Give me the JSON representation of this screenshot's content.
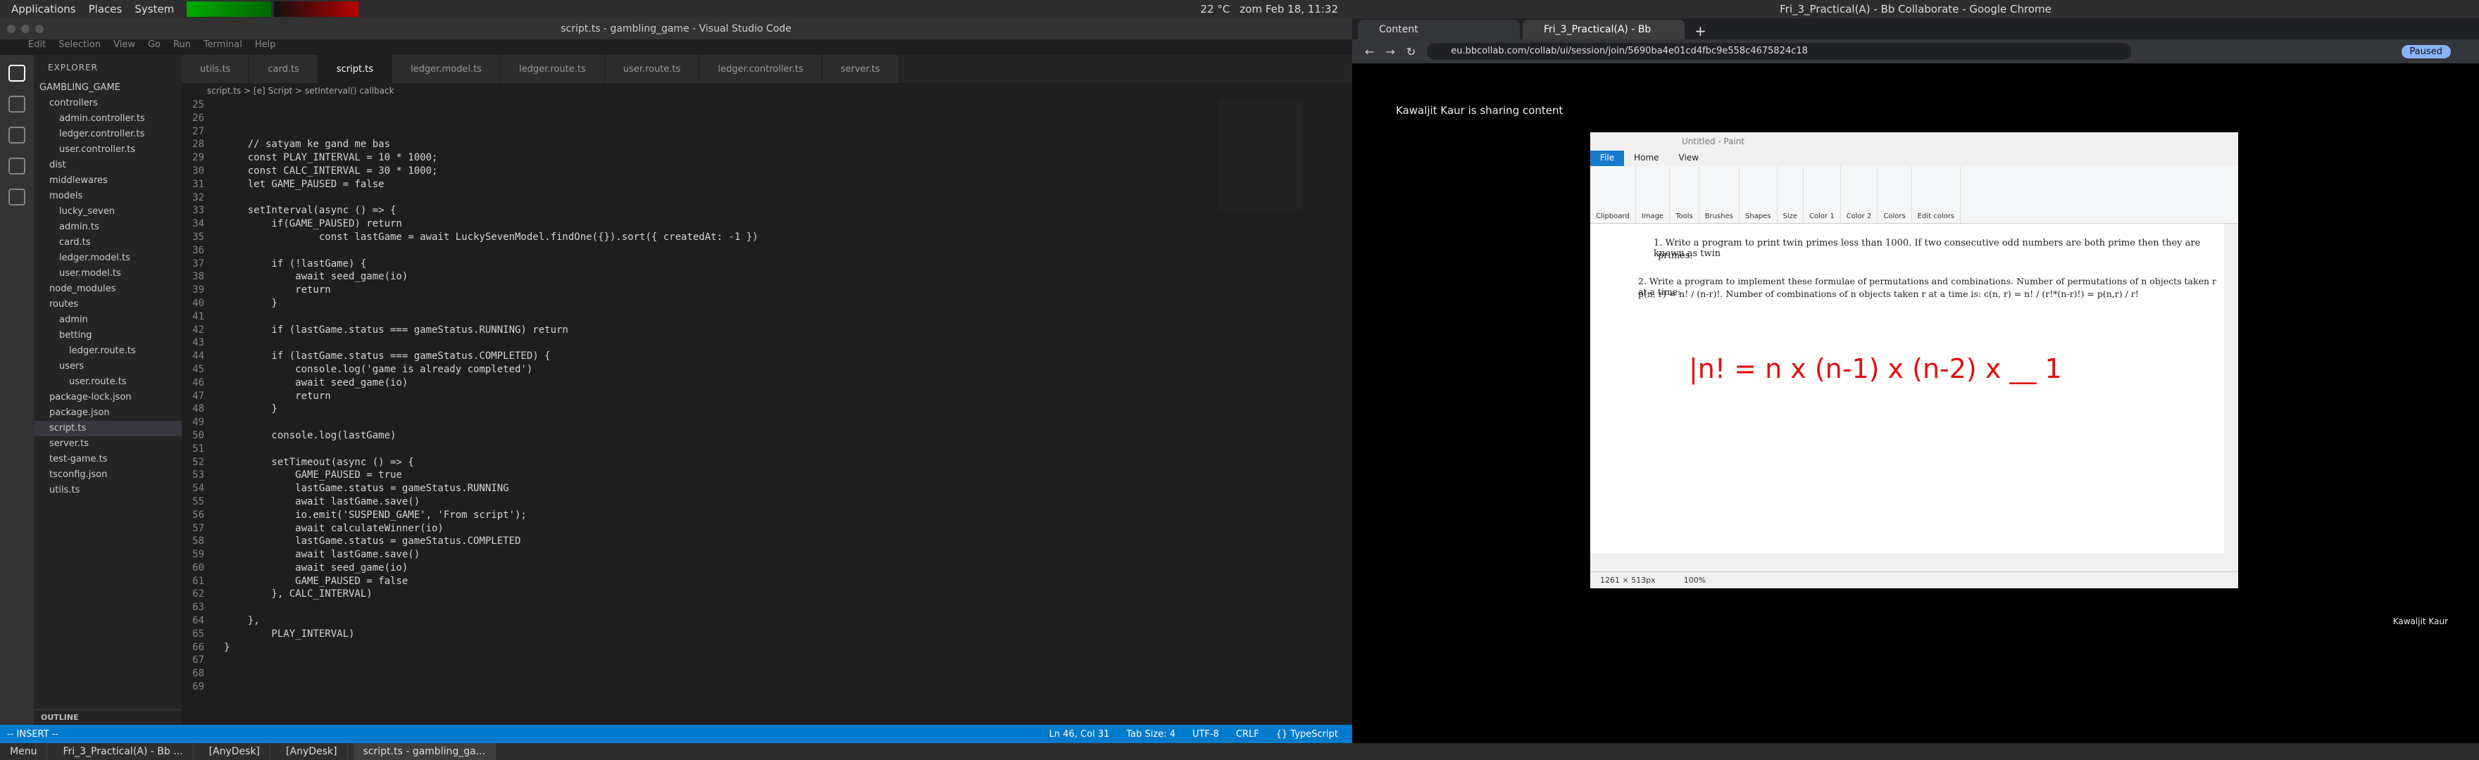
{
  "topbar": {
    "menus": [
      "Applications",
      "Places",
      "System"
    ],
    "weather": "22 °C",
    "clock": "zom Feb 18, 11:32"
  },
  "vscode": {
    "title": "script.ts - gambling_game - Visual Studio Code",
    "menu": [
      "Edit",
      "Selection",
      "View",
      "Go",
      "Run",
      "Terminal",
      "Help"
    ],
    "explorer_title": "EXPLORER",
    "tree": [
      {
        "label": "GAMBLING_GAME"
      },
      {
        "label": "controllers"
      },
      {
        "label": "admin.controller.ts"
      },
      {
        "label": "ledger.controller.ts"
      },
      {
        "label": "user.controller.ts"
      },
      {
        "label": "dist"
      },
      {
        "label": "middlewares"
      },
      {
        "label": "models"
      },
      {
        "label": "lucky_seven"
      },
      {
        "label": "admin.ts"
      },
      {
        "label": "card.ts"
      },
      {
        "label": "ledger.model.ts"
      },
      {
        "label": "user.model.ts"
      },
      {
        "label": "node_modules"
      },
      {
        "label": "routes"
      },
      {
        "label": "admin"
      },
      {
        "label": "betting"
      },
      {
        "label": "ledger.route.ts"
      },
      {
        "label": "users"
      },
      {
        "label": "user.route.ts"
      },
      {
        "label": "package-lock.json"
      },
      {
        "label": "package.json"
      },
      {
        "label": "script.ts"
      },
      {
        "label": "server.ts"
      },
      {
        "label": "test-game.ts"
      },
      {
        "label": "tsconfig.json"
      },
      {
        "label": "utils.ts"
      }
    ],
    "outline": "OUTLINE",
    "tabs": [
      "utils.ts",
      "card.ts",
      "script.ts",
      "ledger.model.ts",
      "ledger.route.ts",
      "user.route.ts",
      "ledger.controller.ts",
      "server.ts"
    ],
    "breadcrumb": "script.ts > [e] Script > setInterval() callback",
    "code_lines": [
      {
        "n": "25",
        "t": ""
      },
      {
        "n": "26",
        "t": ""
      },
      {
        "n": "27",
        "t": ""
      },
      {
        "n": "28",
        "t": "    // satyam ke gand me bas"
      },
      {
        "n": "29",
        "t": "    const PLAY_INTERVAL = 10 * 1000;"
      },
      {
        "n": "30",
        "t": "    const CALC_INTERVAL = 30 * 1000;"
      },
      {
        "n": "31",
        "t": "    let GAME_PAUSED = false"
      },
      {
        "n": "32",
        "t": ""
      },
      {
        "n": "33",
        "t": "    setInterval(async () => {"
      },
      {
        "n": "34",
        "t": "        if(GAME_PAUSED) return"
      },
      {
        "n": "35",
        "t": "                const lastGame = await LuckySevenModel.findOne({}).sort({ createdAt: -1 })"
      },
      {
        "n": "36",
        "t": ""
      },
      {
        "n": "37",
        "t": "        if (!lastGame) {"
      },
      {
        "n": "38",
        "t": "            await seed_game(io)"
      },
      {
        "n": "39",
        "t": "            return"
      },
      {
        "n": "40",
        "t": "        }"
      },
      {
        "n": "41",
        "t": ""
      },
      {
        "n": "42",
        "t": "        if (lastGame.status === gameStatus.RUNNING) return"
      },
      {
        "n": "43",
        "t": ""
      },
      {
        "n": "44",
        "t": "        if (lastGame.status === gameStatus.COMPLETED) {"
      },
      {
        "n": "45",
        "t": "            console.log('game is already completed')"
      },
      {
        "n": "46",
        "t": "            await seed_game(io)"
      },
      {
        "n": "47",
        "t": "            return"
      },
      {
        "n": "48",
        "t": "        }"
      },
      {
        "n": "49",
        "t": ""
      },
      {
        "n": "50",
        "t": "        console.log(lastGame)"
      },
      {
        "n": "51",
        "t": ""
      },
      {
        "n": "52",
        "t": "        setTimeout(async () => {"
      },
      {
        "n": "53",
        "t": "            GAME_PAUSED = true"
      },
      {
        "n": "54",
        "t": "            lastGame.status = gameStatus.RUNNING"
      },
      {
        "n": "55",
        "t": "            await lastGame.save()"
      },
      {
        "n": "56",
        "t": "            io.emit('SUSPEND_GAME', 'From script');"
      },
      {
        "n": "57",
        "t": "            await calculateWinner(io)"
      },
      {
        "n": "58",
        "t": "            lastGame.status = gameStatus.COMPLETED"
      },
      {
        "n": "59",
        "t": "            await lastGame.save()"
      },
      {
        "n": "60",
        "t": "            await seed_game(io)"
      },
      {
        "n": "61",
        "t": "            GAME_PAUSED = false"
      },
      {
        "n": "62",
        "t": "        }, CALC_INTERVAL)"
      },
      {
        "n": "63",
        "t": ""
      },
      {
        "n": "64",
        "t": "    },"
      },
      {
        "n": "65",
        "t": "        PLAY_INTERVAL)"
      },
      {
        "n": "66",
        "t": "}"
      },
      {
        "n": "67",
        "t": ""
      },
      {
        "n": "68",
        "t": ""
      },
      {
        "n": "69",
        "t": ""
      }
    ],
    "status": {
      "mode": "-- INSERT --",
      "position": "Ln 46, Col 31",
      "tab": "Tab Size: 4",
      "enc": "UTF-8",
      "eol": "CRLF",
      "lang": "{} TypeScript"
    }
  },
  "chrome": {
    "title": "Fri_3_Practical(A) - Bb Collaborate - Google Chrome",
    "tabs": [
      "Content",
      "Fri_3_Practical(A) - Bb"
    ],
    "url": "eu.bbcollab.com/collab/ui/session/join/5690ba4e01cd4fbc9e558c4675824c18",
    "paused": "Paused",
    "sharing": "Kawaljit Kaur is sharing content",
    "paint": {
      "title": "Untitled - Paint",
      "tabs": [
        "File",
        "Home",
        "View"
      ],
      "groups": [
        "Clipboard",
        "Image",
        "Tools",
        "Brushes",
        "Shapes",
        "Size",
        "Color 1",
        "Color 2",
        "Colors",
        "Edit colors"
      ],
      "q1a": "1.  Write a program to print twin primes less than 1000.  If two consecutive odd numbers are both prime then they are known as twin",
      "q1b": "primes.",
      "q2a": "2. Write a program to implement these formulae of permutations and combinations. Number of permutations of n objects taken r at a time:",
      "q2b": "p(n, r) = n! / (n-r)!.  Number of combinations of n objects taken r at a time is: c(n, r) = n! / (r!*(n-r)!) = p(n,r) / r!",
      "hand": "|n!  = n x (n-1) x (n-2) x    __ 1",
      "dims": "1261 × 513px",
      "zoom": "100%"
    },
    "presenter": "Kawaljit Kaur"
  },
  "taskbar": {
    "items": [
      "Menu",
      "Fri_3_Practical(A) - Bb ...",
      "[AnyDesk]",
      "[AnyDesk]",
      "script.ts - gambling_ga..."
    ]
  }
}
